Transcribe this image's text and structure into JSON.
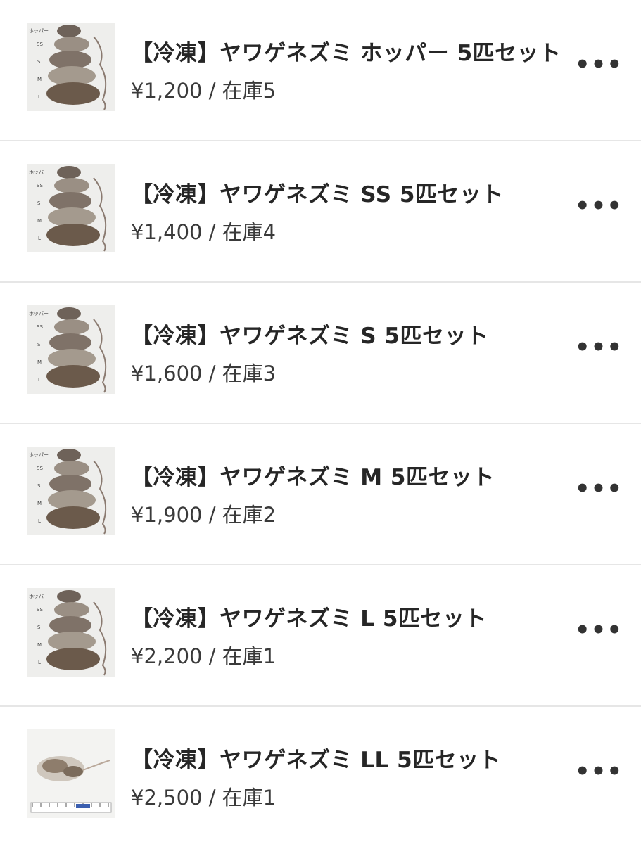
{
  "products": [
    {
      "title": "【冷凍】ヤワゲネズミ ホッパー 5匹セット",
      "meta": "¥1,200 / 在庫5",
      "image": "mice-size-chart",
      "more_icon": "ellipsis-icon"
    },
    {
      "title": "【冷凍】ヤワゲネズミ SS 5匹セット",
      "meta": "¥1,400 / 在庫4",
      "image": "mice-size-chart",
      "more_icon": "ellipsis-icon"
    },
    {
      "title": "【冷凍】ヤワゲネズミ S 5匹セット",
      "meta": "¥1,600 / 在庫3",
      "image": "mice-size-chart",
      "more_icon": "ellipsis-icon"
    },
    {
      "title": "【冷凍】ヤワゲネズミ M 5匹セット",
      "meta": "¥1,900 / 在庫2",
      "image": "mice-size-chart",
      "more_icon": "ellipsis-icon"
    },
    {
      "title": "【冷凍】ヤワゲネズミ L 5匹セット",
      "meta": "¥2,200 / 在庫1",
      "image": "mice-size-chart",
      "more_icon": "ellipsis-icon"
    },
    {
      "title": "【冷凍】ヤワゲネズミ LL 5匹セット",
      "meta": "¥2,500 / 在庫1",
      "image": "single-mouse-on-ruler",
      "more_icon": "ellipsis-icon"
    }
  ],
  "size_chart_labels": [
    "ホッパー",
    "SS",
    "S",
    "M",
    "L"
  ],
  "more_glyph": "•••"
}
